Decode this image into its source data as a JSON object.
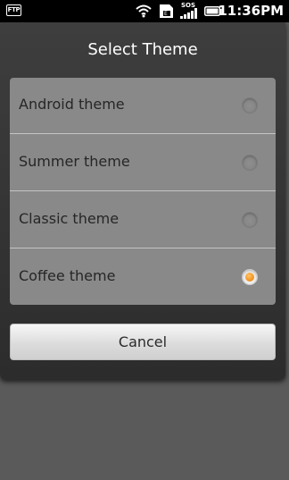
{
  "status_bar": {
    "ftp_label": "FTP",
    "sos_label": "SOS",
    "time": "11:36PM",
    "icons": [
      "ftp-icon",
      "wifi-icon",
      "sd-card-icon",
      "signal-icon",
      "battery-icon"
    ]
  },
  "dialog": {
    "title": "Select Theme",
    "options": [
      {
        "label": "Android theme",
        "selected": false
      },
      {
        "label": "Summer theme",
        "selected": false
      },
      {
        "label": "Classic theme",
        "selected": false
      },
      {
        "label": "Coffee theme",
        "selected": true
      }
    ],
    "cancel_label": "Cancel"
  },
  "colors": {
    "accent_radio": "#f39a2a",
    "list_background": "#898989",
    "dialog_background": "#333333",
    "page_background": "#5a5a5a"
  }
}
